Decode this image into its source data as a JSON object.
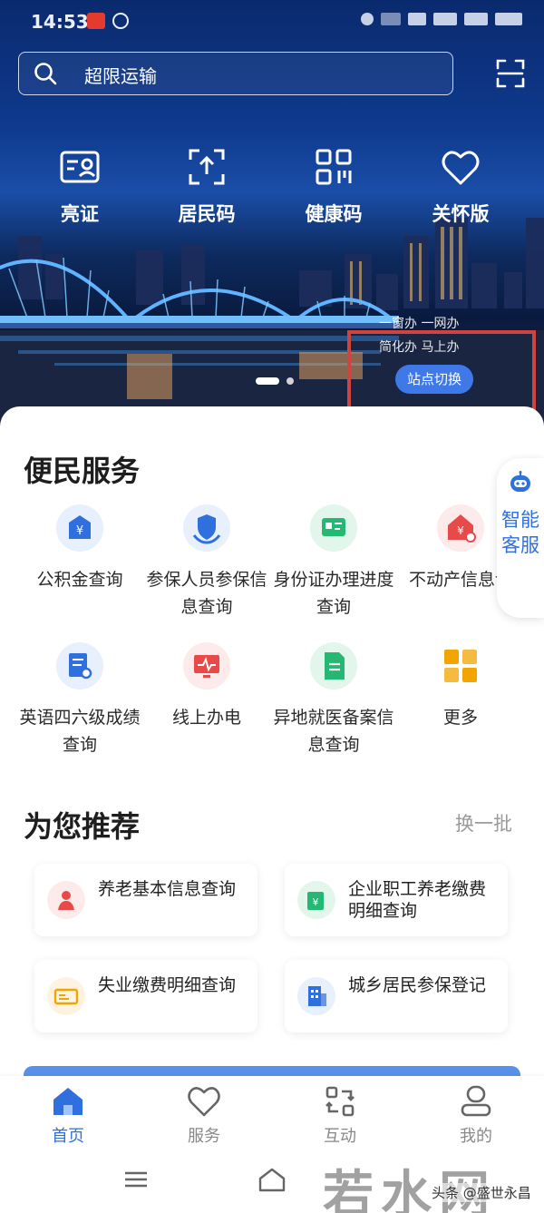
{
  "status_bar": {
    "time": "14:53"
  },
  "search": {
    "placeholder": "超限运输"
  },
  "quick_actions": [
    {
      "label": "亮证",
      "icon": "id-card-icon"
    },
    {
      "label": "居民码",
      "icon": "upload-code-icon"
    },
    {
      "label": "健康码",
      "icon": "qr-grid-icon"
    },
    {
      "label": "关怀版",
      "icon": "heart-icon"
    }
  ],
  "banner": {
    "line1": "一窗办 一网办",
    "line2": "简化办 马上办",
    "site_switch": "站点切换"
  },
  "convenience": {
    "title": "便民服务",
    "items": [
      {
        "label": "公积金查询",
        "icon": "housing-fund-icon",
        "color": "#2f6fde",
        "bg": "#e8f0fd"
      },
      {
        "label": "参保人员参保信息查询",
        "icon": "insurance-shield-icon",
        "color": "#2f6fde",
        "bg": "#e8f0fd"
      },
      {
        "label": "身份证办理进度查询",
        "icon": "id-progress-icon",
        "color": "#25b873",
        "bg": "#e3f6ec"
      },
      {
        "label": "不动产信息询",
        "icon": "property-icon",
        "color": "#e84a4a",
        "bg": "#fdeaea"
      },
      {
        "label": "英语四六级成绩查询",
        "icon": "exam-score-icon",
        "color": "#2f6fde",
        "bg": "#e8f0fd"
      },
      {
        "label": "线上办电",
        "icon": "electricity-icon",
        "color": "#e84a4a",
        "bg": "#fdeaea"
      },
      {
        "label": "异地就医备案信息查询",
        "icon": "medical-record-icon",
        "color": "#25b873",
        "bg": "#e3f6ec"
      },
      {
        "label": "更多",
        "icon": "more-grid-icon",
        "color": "#f2a400",
        "bg": "#ffffff"
      }
    ]
  },
  "ai_service": {
    "label": "智能客服"
  },
  "recommend": {
    "title": "为您推荐",
    "swap": "换一批",
    "items": [
      {
        "label": "养老基本信息查询",
        "icon": "pension-icon",
        "color": "#e84a4a",
        "bg": "#fdeaea"
      },
      {
        "label": "企业职工养老缴费明细查询",
        "icon": "employee-pension-icon",
        "color": "#25b873",
        "bg": "#e3f6ec"
      },
      {
        "label": "失业缴费明细查询",
        "icon": "unemployment-icon",
        "color": "#f2a400",
        "bg": "#fdf3e0"
      },
      {
        "label": "城乡居民参保登记",
        "icon": "resident-insurance-icon",
        "color": "#2f6fde",
        "bg": "#e8f0fd"
      }
    ]
  },
  "tabs": [
    {
      "label": "首页",
      "icon": "home-icon",
      "active": true
    },
    {
      "label": "服务",
      "icon": "heart-outline-icon",
      "active": false
    },
    {
      "label": "互动",
      "icon": "interaction-icon",
      "active": false
    },
    {
      "label": "我的",
      "icon": "profile-icon",
      "active": false
    }
  ],
  "watermark": {
    "text": "若水网",
    "credit": "头条 @盛世永昌"
  },
  "colors": {
    "accent": "#2f6fde",
    "highlight_border": "#d0433f"
  }
}
